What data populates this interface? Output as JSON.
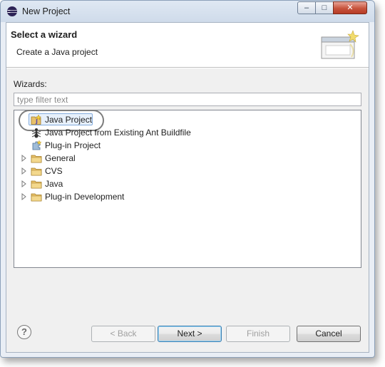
{
  "window": {
    "title": "New Project",
    "controls": {
      "minimize": "–",
      "maximize": "□",
      "close": "✕"
    }
  },
  "banner": {
    "title": "Select a wizard",
    "description": "Create a Java project"
  },
  "wizards": {
    "label": "Wizards:",
    "filter_placeholder": "type filter text",
    "items": [
      {
        "label": "Java Project",
        "icon": "java-project-icon",
        "expandable": false,
        "selected": true
      },
      {
        "label": "Java Project from Existing Ant Buildfile",
        "icon": "ant-icon",
        "expandable": false,
        "selected": false
      },
      {
        "label": "Plug-in Project",
        "icon": "plugin-project-icon",
        "expandable": false,
        "selected": false
      },
      {
        "label": "General",
        "icon": "folder-icon",
        "expandable": true,
        "selected": false
      },
      {
        "label": "CVS",
        "icon": "folder-icon",
        "expandable": true,
        "selected": false
      },
      {
        "label": "Java",
        "icon": "folder-icon",
        "expandable": true,
        "selected": false
      },
      {
        "label": "Plug-in Development",
        "icon": "folder-icon",
        "expandable": true,
        "selected": false
      }
    ]
  },
  "buttons": {
    "help": "?",
    "back": "< Back",
    "next": "Next >",
    "finish": "Finish",
    "cancel": "Cancel"
  },
  "colors": {
    "selection_fill": "#e7f0fb",
    "selection_border": "#84acdd",
    "annotation_ring": "#7d7d7d",
    "folder": "#e8c16a"
  }
}
